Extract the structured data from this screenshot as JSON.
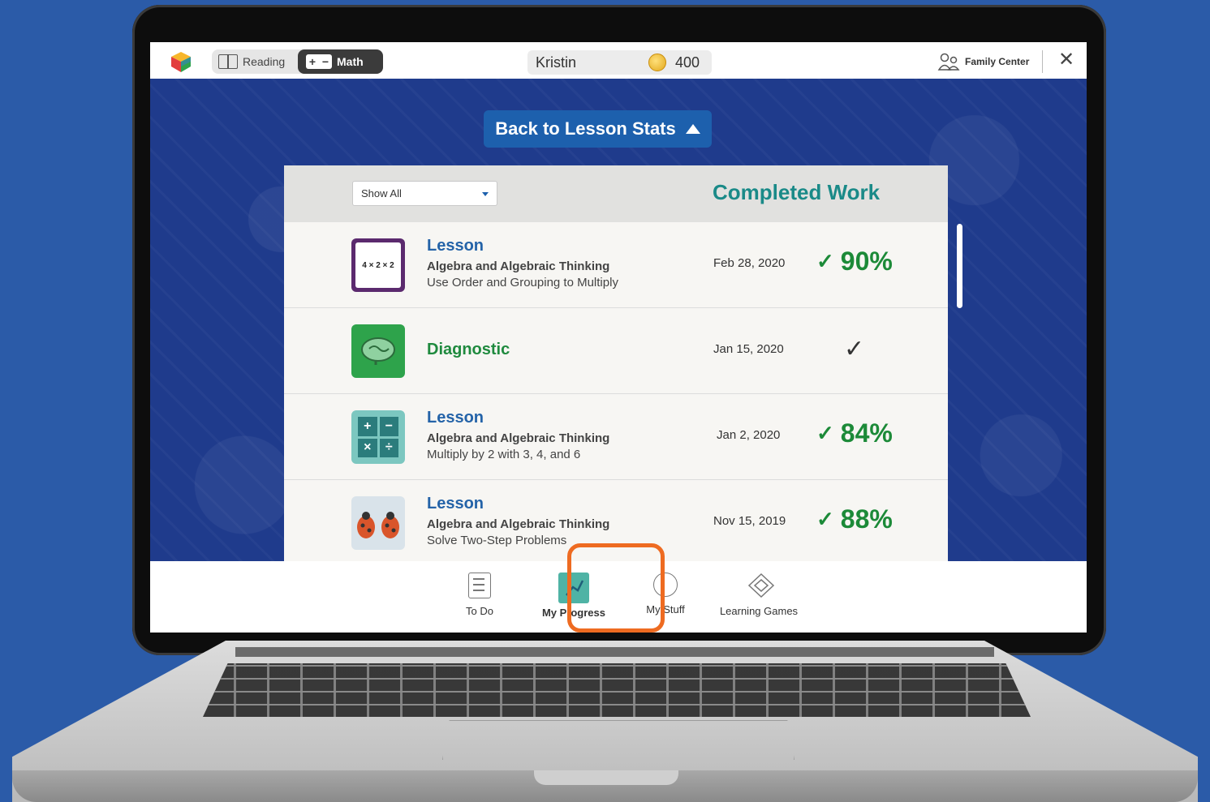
{
  "topbar": {
    "subjects": [
      {
        "label": "Reading",
        "active": false
      },
      {
        "label": "Math",
        "active": true
      }
    ],
    "math_icon": {
      "plus": "+",
      "minus": "−"
    },
    "user_name": "Kristin",
    "coins": "400",
    "family_center": "Family Center",
    "close_glyph": "✕"
  },
  "back_button": {
    "label": "Back to Lesson Stats"
  },
  "panel": {
    "filter_value": "Show All",
    "heading": "Completed Work",
    "rows": [
      {
        "type": "Lesson",
        "subject": "Algebra and Algebraic Thinking",
        "topic": "Use Order and Grouping to Multiply",
        "date": "Feb 28, 2020",
        "score": "90%",
        "thumb_text": "4 × 2 × 2",
        "check": "✓"
      },
      {
        "type": "Diagnostic",
        "subject": "",
        "topic": "",
        "date": "Jan 15, 2020",
        "score": "",
        "check": "✓"
      },
      {
        "type": "Lesson",
        "subject": "Algebra and Algebraic Thinking",
        "topic": "Multiply by 2 with 3, 4, and 6",
        "date": "Jan 2, 2020",
        "score": "84%",
        "thumb_ops": [
          "+",
          "−",
          "×",
          "÷"
        ],
        "check": "✓"
      },
      {
        "type": "Lesson",
        "subject": "Algebra and Algebraic Thinking",
        "topic": "Solve Two-Step Problems",
        "date": "Nov 15, 2019",
        "score": "88%",
        "check": "✓"
      }
    ]
  },
  "bottom_nav": [
    {
      "label": "To Do",
      "icon": "checklist-icon",
      "active": false
    },
    {
      "label": "My Progress",
      "icon": "progress-icon",
      "active": true
    },
    {
      "label": "My Stuff",
      "icon": "smiley-icon",
      "active": false
    },
    {
      "label": "Learning Games",
      "icon": "games-icon",
      "active": false
    }
  ],
  "colors": {
    "background": "#2b5ba8",
    "accent_blue": "#1d60ad",
    "heading_teal": "#1a8a88",
    "score_green": "#1c8a38",
    "highlight_orange": "#ee6b21"
  }
}
